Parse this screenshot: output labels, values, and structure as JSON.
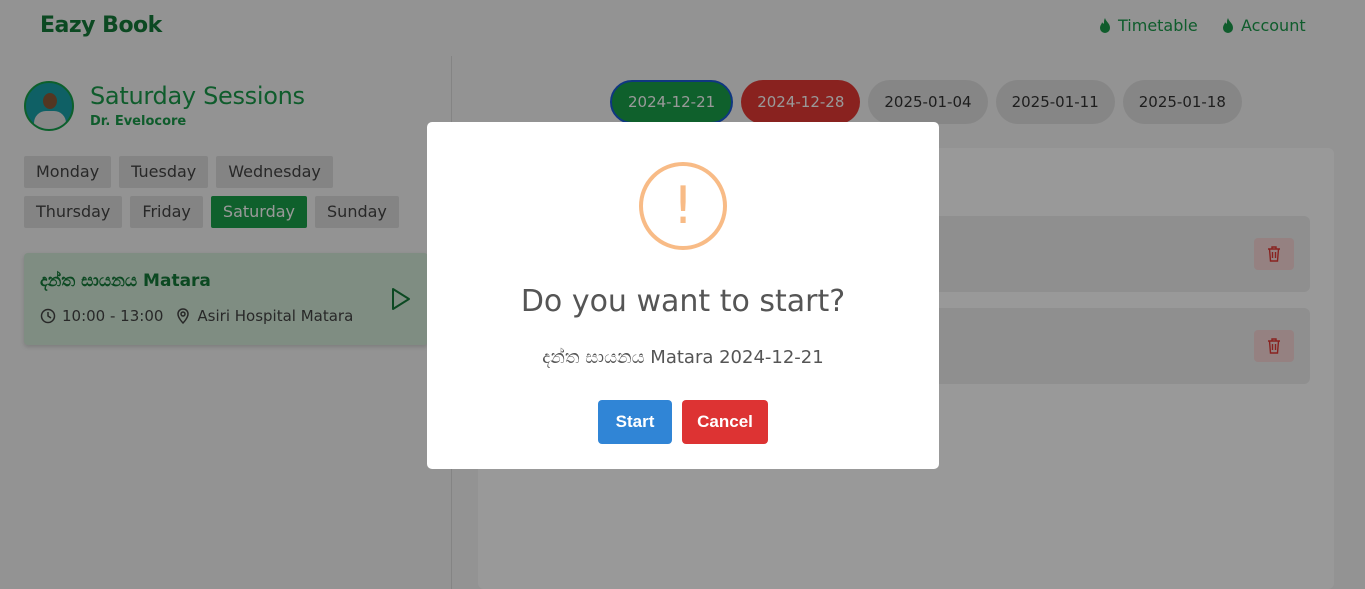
{
  "header": {
    "brand": "Eazy Book",
    "nav": [
      {
        "label": "Timetable",
        "icon": "fire-icon"
      },
      {
        "label": "Account",
        "icon": "fire-icon"
      }
    ]
  },
  "sidebar": {
    "title": "Saturday Sessions",
    "doctor": "Dr. Evelocore",
    "days": [
      "Monday",
      "Tuesday",
      "Wednesday",
      "Thursday",
      "Friday",
      "Saturday",
      "Sunday"
    ],
    "active_day": "Saturday",
    "session": {
      "name": "දන්ත සායනය Matara",
      "time": "10:00 - 13:00",
      "location": "Asiri Hospital Matara"
    }
  },
  "main": {
    "dates": [
      "2024-12-21",
      "2024-12-28",
      "2025-01-04",
      "2025-01-11",
      "2025-01-18"
    ],
    "selected_date": "2024-12-21"
  },
  "modal": {
    "icon": "!",
    "title": "Do you want to start?",
    "text": "දන්ත සායනය Matara 2024-12-21",
    "start_label": "Start",
    "cancel_label": "Cancel"
  },
  "colors": {
    "brand_green": "#157a3a",
    "accent_green": "#1aa04a",
    "danger_red": "#dd3333",
    "primary_blue": "#3085d6",
    "warning_orange": "#f8bb86"
  }
}
